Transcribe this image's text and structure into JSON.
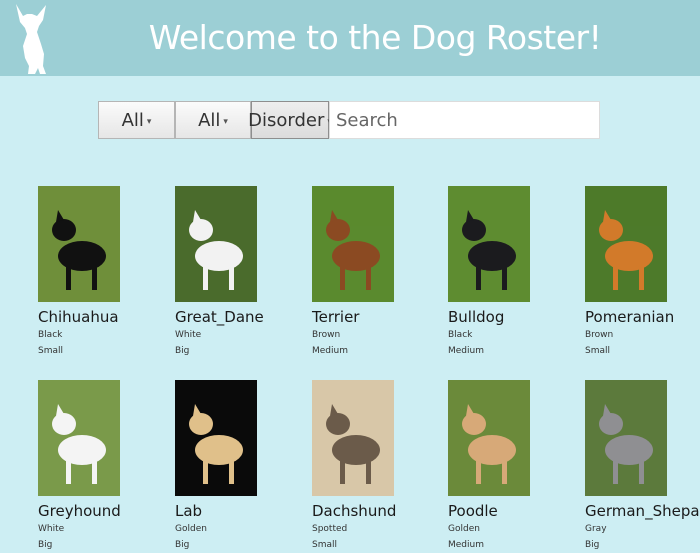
{
  "header": {
    "title": "Welcome to the Dog Roster!",
    "logo_icon": "chihuahua-silhouette-icon"
  },
  "filters": {
    "color_select": "All",
    "size_select": "All",
    "disorder_button": "Disorder",
    "search_placeholder": "Search",
    "search_value": ""
  },
  "dogs": [
    {
      "name": "Chihuahua",
      "color": "Black",
      "size": "Small",
      "photo_palette": [
        "#6f8f3a",
        "#111111"
      ]
    },
    {
      "name": "Great_Dane",
      "color": "White",
      "size": "Big",
      "photo_palette": [
        "#4a6b2c",
        "#f2f2f2"
      ]
    },
    {
      "name": "Terrier",
      "color": "Brown",
      "size": "Medium",
      "photo_palette": [
        "#5a8a2e",
        "#8b4a22"
      ]
    },
    {
      "name": "Bulldog",
      "color": "Black",
      "size": "Medium",
      "photo_palette": [
        "#5e8c30",
        "#1b1b1e"
      ]
    },
    {
      "name": "Pomeranian",
      "color": "Brown",
      "size": "Small",
      "photo_palette": [
        "#4d7a2a",
        "#d27a2a"
      ]
    },
    {
      "name": "Greyhound",
      "color": "White",
      "size": "Big",
      "photo_palette": [
        "#7a9a4a",
        "#f4f4f4"
      ]
    },
    {
      "name": "Lab",
      "color": "Golden",
      "size": "Big",
      "photo_palette": [
        "#0a0a0a",
        "#e0c08a"
      ]
    },
    {
      "name": "Dachshund",
      "color": "Spotted",
      "size": "Small",
      "photo_palette": [
        "#d8c7a8",
        "#6b5b4a"
      ]
    },
    {
      "name": "Poodle",
      "color": "Golden",
      "size": "Medium",
      "photo_palette": [
        "#6b8a3a",
        "#d7a978"
      ]
    },
    {
      "name": "German_Shepard",
      "color": "Gray",
      "size": "Big",
      "photo_palette": [
        "#5c7a3c",
        "#8f8f92"
      ]
    }
  ]
}
